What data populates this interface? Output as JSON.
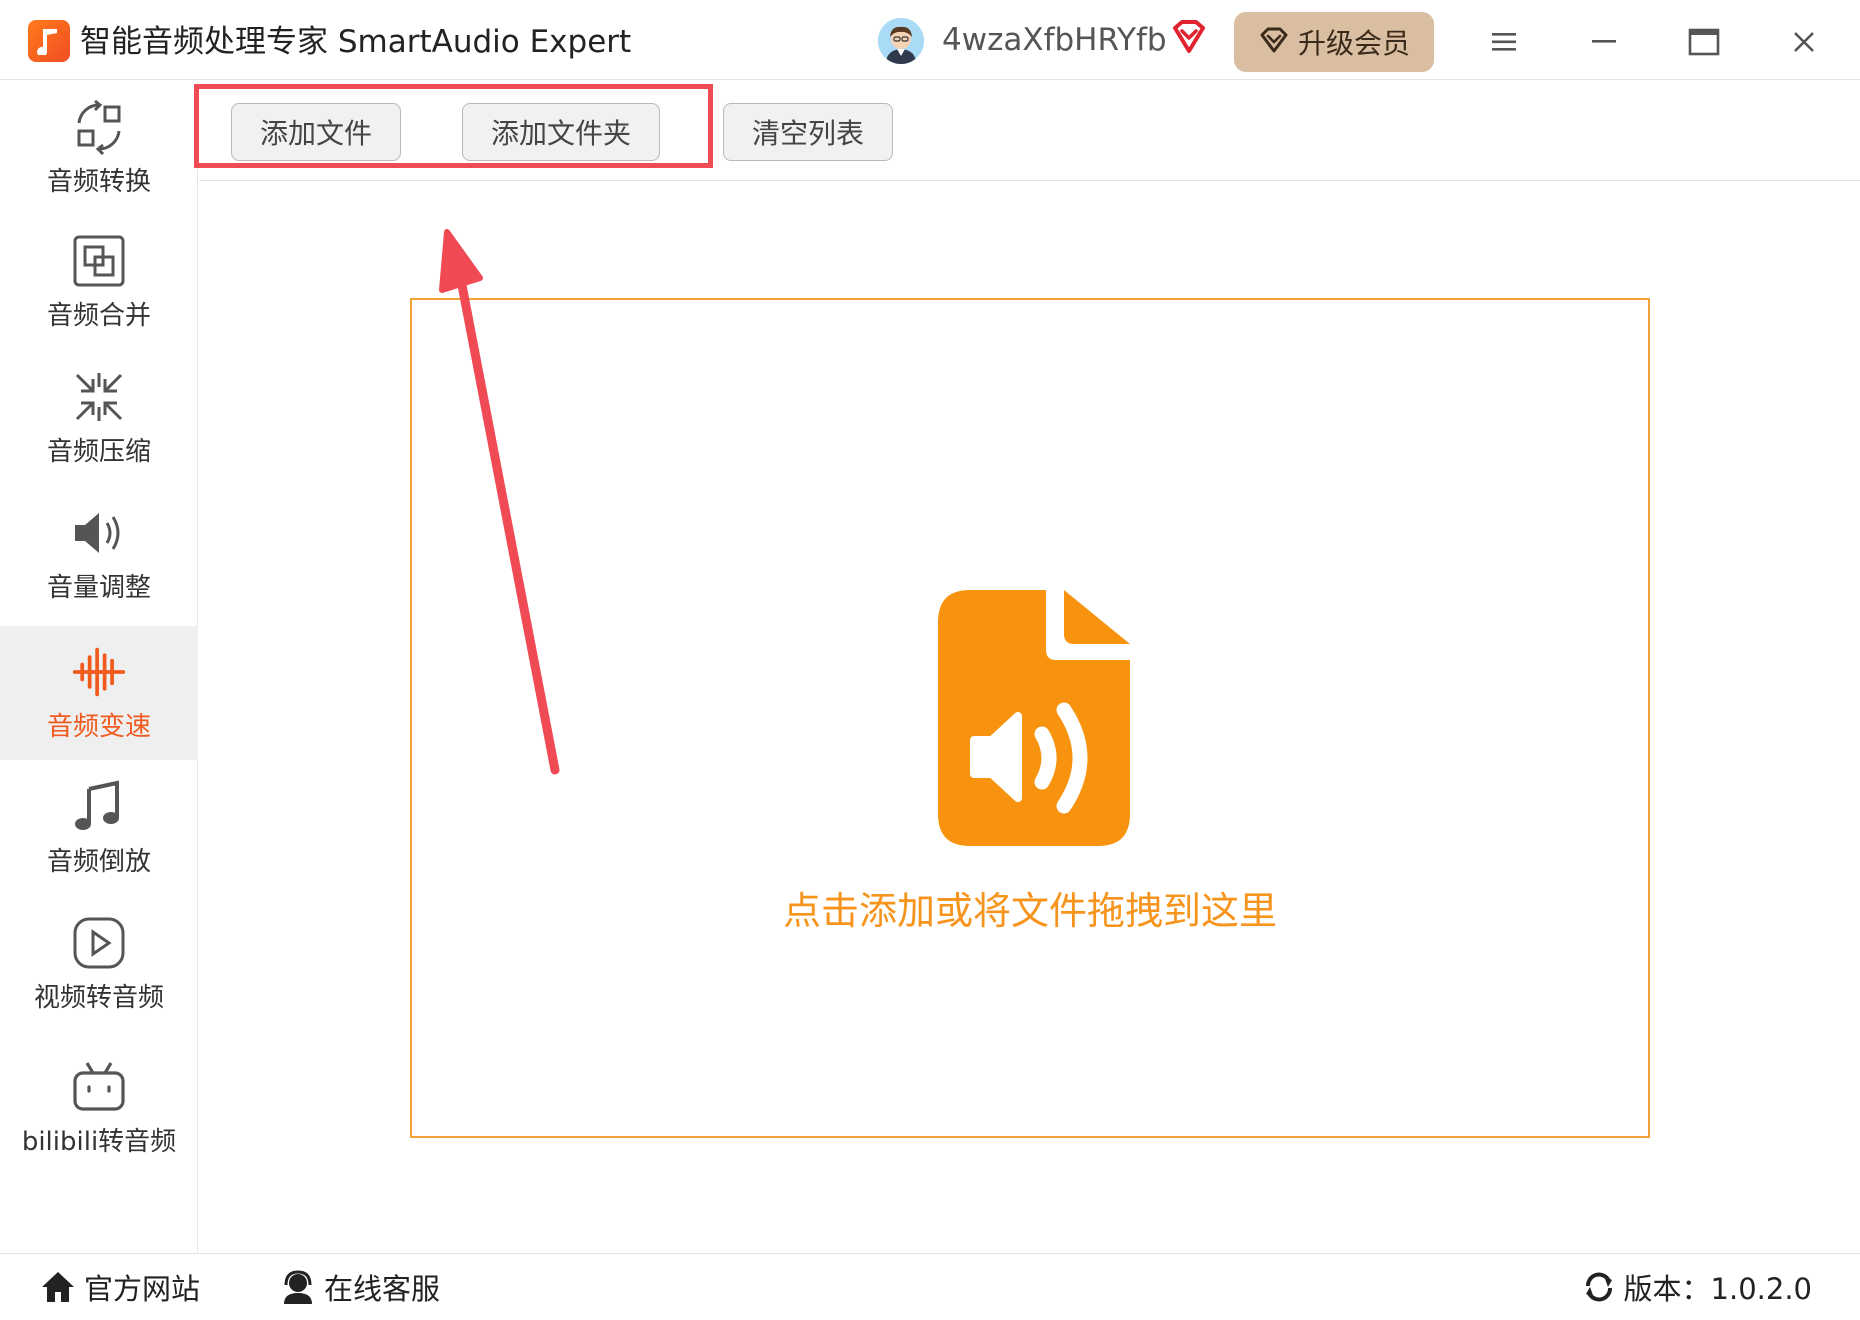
{
  "titlebar": {
    "app_title": "智能音频处理专家 SmartAudio Expert",
    "username": "4wzaXfbHRYfb",
    "upgrade_label": "升级会员",
    "accent_color": "#f05a1e"
  },
  "sidebar": {
    "items": [
      {
        "label": "音频转换",
        "icon": "audio-convert-icon",
        "active": false
      },
      {
        "label": "音频合并",
        "icon": "audio-merge-icon",
        "active": false
      },
      {
        "label": "音频压缩",
        "icon": "audio-compress-icon",
        "active": false
      },
      {
        "label": "音量调整",
        "icon": "volume-icon",
        "active": false
      },
      {
        "label": "音频变速",
        "icon": "speed-waveform-icon",
        "active": true
      },
      {
        "label": "音频倒放",
        "icon": "music-note-icon",
        "active": false
      },
      {
        "label": "视频转音频",
        "icon": "play-icon",
        "active": false
      },
      {
        "label": "bilibili转音频",
        "icon": "bilibili-tv-icon",
        "active": false
      }
    ]
  },
  "toolbar": {
    "add_file": "添加文件",
    "add_folder": "添加文件夹",
    "clear_list": "清空列表"
  },
  "dropzone": {
    "text": "点击添加或将文件拖拽到这里",
    "icon": "audio-file-icon",
    "color": "#f7941d"
  },
  "footer": {
    "website": "官方网站",
    "support": "在线客服",
    "version": "版本：1.0.2.0"
  }
}
